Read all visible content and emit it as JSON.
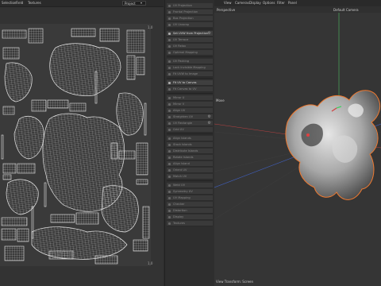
{
  "uv_editor": {
    "menu": [
      "Selection",
      "Field",
      "Textures"
    ],
    "project_select": "Project",
    "corner_top_right": "1,0",
    "corner_bottom_right": "1,0"
  },
  "tool_panel": {
    "items": [
      {
        "label": "UV Projection",
        "active": false
      },
      {
        "label": "Frontal Projection",
        "active": false
      },
      {
        "label": "Box Projection",
        "active": false
      },
      {
        "label": "UV Unwrap",
        "active": false
      },
      {
        "label": "Set UVW from Projection",
        "active": true,
        "gear": true
      },
      {
        "label": "UV Terrace",
        "active": false
      },
      {
        "label": "UV Relax",
        "active": false
      },
      {
        "label": "Optimal Mapping",
        "active": false
      },
      {
        "label": "UV Packing",
        "active": false
      },
      {
        "label": "Lock Invisible Mapping",
        "active": false
      },
      {
        "label": "Fit UVW to Image",
        "active": false
      },
      {
        "label": "Fit UV to Canvas",
        "active": true
      },
      {
        "label": "Fit Canvas to UV",
        "active": false
      },
      {
        "label": "Mirror U",
        "active": false
      },
      {
        "label": "Mirror V",
        "active": false
      },
      {
        "label": "Align UV",
        "active": false
      },
      {
        "label": "Straighten UV",
        "active": false,
        "gear": true
      },
      {
        "label": "UV Rectangle",
        "active": false,
        "gear": true
      },
      {
        "label": "Grid UV",
        "active": false
      },
      {
        "label": "Align Islands",
        "active": false
      },
      {
        "label": "Stack Islands",
        "active": false
      },
      {
        "label": "Distribute Islands",
        "active": false
      },
      {
        "label": "Rotate Islands",
        "active": false
      },
      {
        "label": "Align Island",
        "active": false
      },
      {
        "label": "Orient UV",
        "active": false
      },
      {
        "label": "Match UV",
        "active": false
      },
      {
        "label": "Weld UV",
        "active": false
      },
      {
        "label": "Symmetry UV",
        "active": false
      },
      {
        "label": "UV Mapping",
        "active": false
      },
      {
        "label": "Checker",
        "active": false
      },
      {
        "label": "Distortion",
        "active": false
      },
      {
        "label": "Display",
        "active": false
      },
      {
        "label": "Textures",
        "active": false
      }
    ]
  },
  "viewport": {
    "menu": [
      "View",
      "Cameras",
      "Display",
      "Options",
      "Filter",
      "Panel"
    ],
    "projection_label": "Perspective",
    "camera_label": "Default Camera",
    "tool_label": "Move",
    "status_label": "View Transform: Screen"
  },
  "colors": {
    "accent": "#f07a30",
    "axis_x": "#d04040",
    "axis_y": "#40c060",
    "axis_z": "#4060d0",
    "uv_lines": "#e0e0e0"
  }
}
